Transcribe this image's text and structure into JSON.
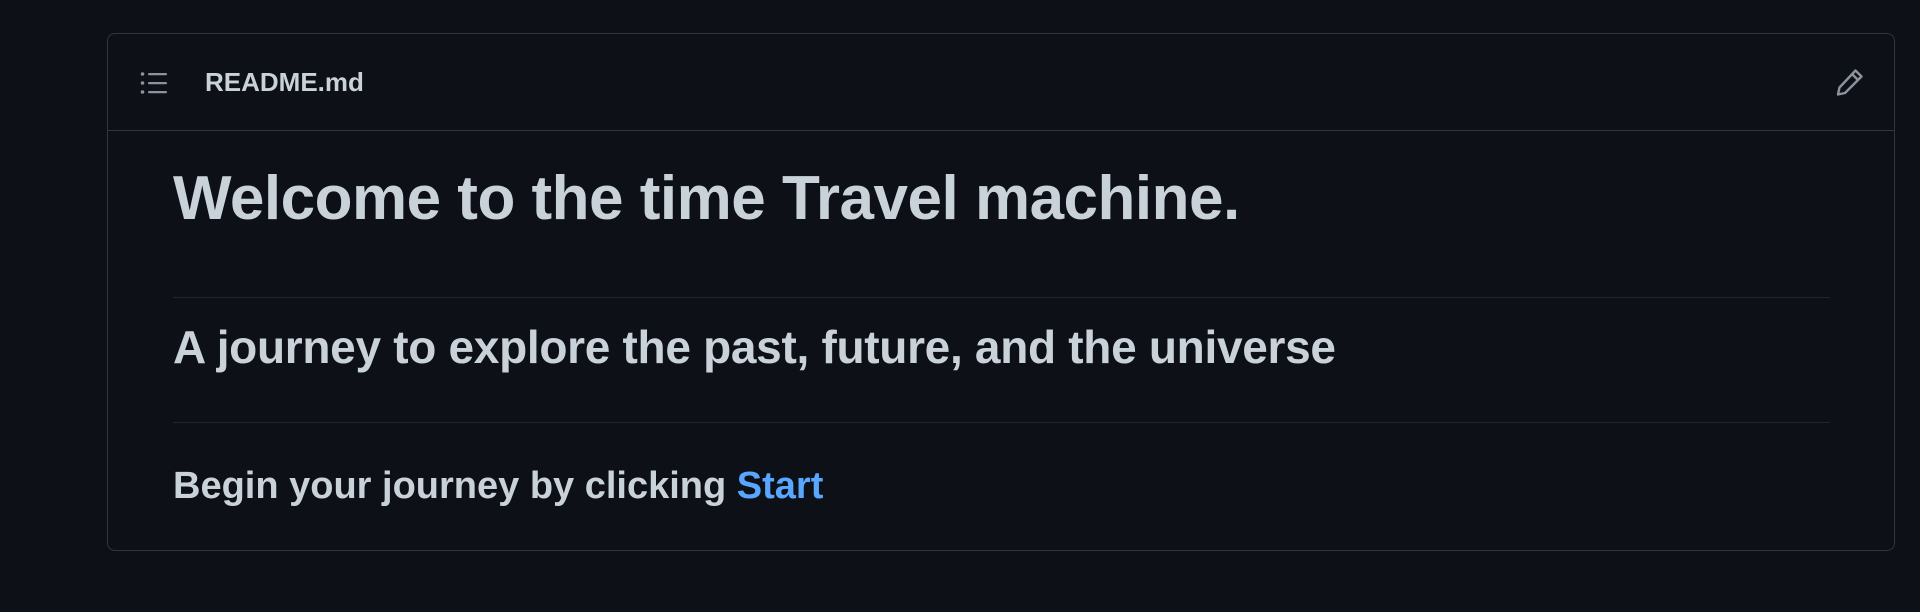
{
  "header": {
    "toc_icon": "list-unordered-icon",
    "file_name": "README.md",
    "edit_icon": "pencil-icon"
  },
  "content": {
    "heading1": "Welcome to the time Travel machine.",
    "heading2": "A journey to explore the past, future, and the universe",
    "paragraph_text": "Begin your journey by clicking ",
    "link_text": "Start"
  },
  "colors": {
    "background": "#0d1117",
    "border": "#30363d",
    "text": "#c9d1d9",
    "link": "#58a6ff"
  }
}
